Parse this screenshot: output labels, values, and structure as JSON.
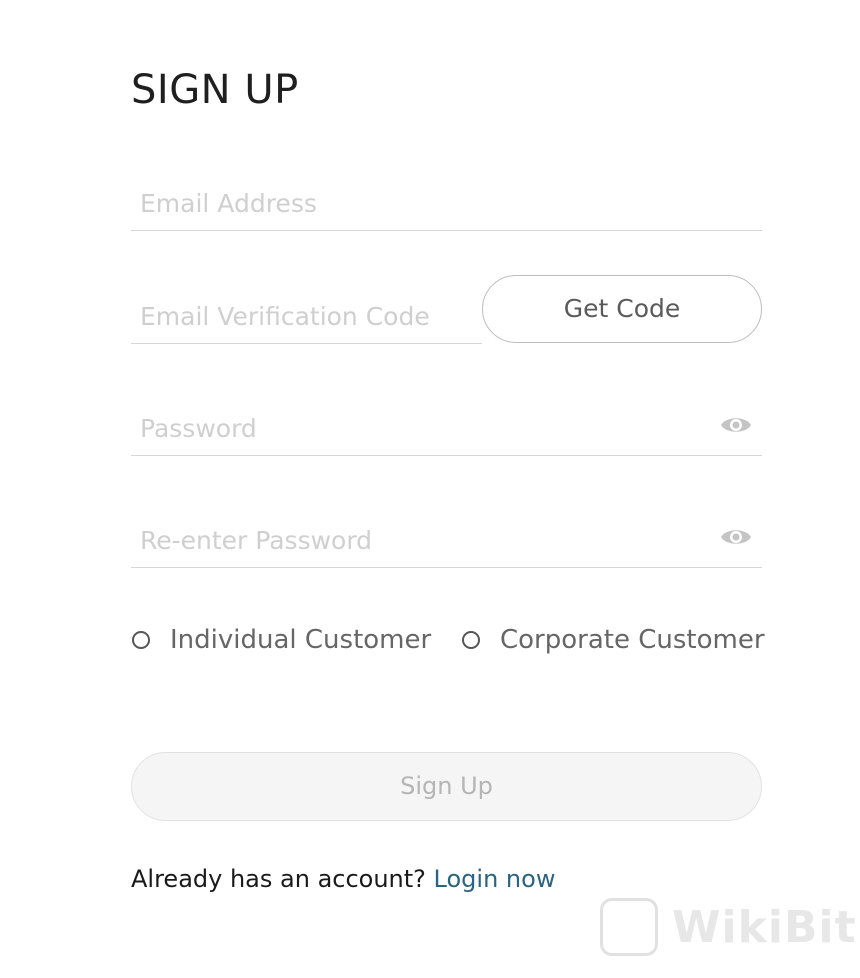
{
  "title": "SIGN UP",
  "fields": {
    "email_placeholder": "Email Address",
    "email_value": "",
    "code_placeholder": "Email Verification Code",
    "code_value": "",
    "password_placeholder": "Password",
    "password_value": "",
    "reenter_placeholder": "Re-enter Password",
    "reenter_value": ""
  },
  "get_code_label": "Get Code",
  "customer_type": {
    "options": [
      "Individual Customer",
      "Corporate Customer"
    ],
    "selected": null
  },
  "signup_label": "Sign Up",
  "footer": {
    "prompt": "Already has an account? ",
    "link": "Login now"
  },
  "watermark": {
    "text": "WikiBit"
  },
  "colors": {
    "link": "#2a6482",
    "placeholder": "#cfcfcf",
    "underline": "#d6d6d6",
    "button_disabled_bg": "#f5f5f5"
  },
  "icons": {
    "password_toggle": "eye-icon"
  }
}
